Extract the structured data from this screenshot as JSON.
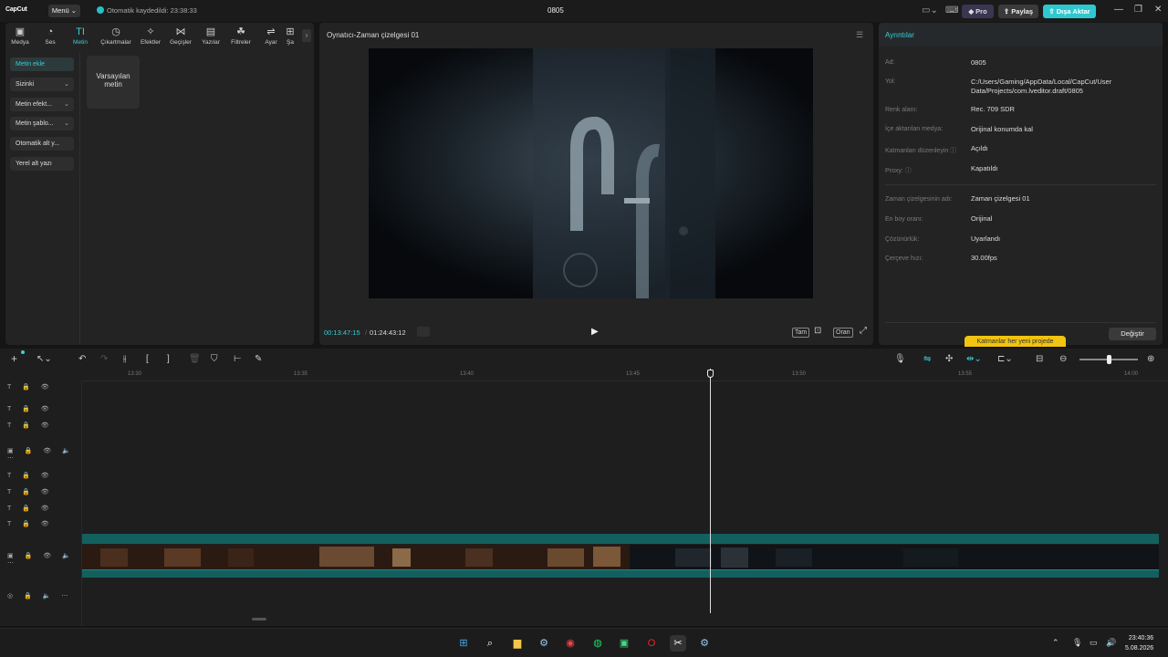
{
  "titlebar": {
    "logo": "CapCut",
    "menu_label": "Menü",
    "autosave": "Otomatik kaydedildi: 23:38:33",
    "project_name": "0805",
    "pro_label": "Pro",
    "share_label": "Paylaş",
    "export_label": "Dışa Aktar"
  },
  "tabs": [
    {
      "label": "Medya",
      "icon": "media-icon"
    },
    {
      "label": "Ses",
      "icon": "audio-icon"
    },
    {
      "label": "Metin",
      "icon": "text-icon"
    },
    {
      "label": "Çıkartmalar",
      "icon": "sticker-icon"
    },
    {
      "label": "Efektler",
      "icon": "effects-icon"
    },
    {
      "label": "Geçişler",
      "icon": "transitions-icon"
    },
    {
      "label": "Yazılar",
      "icon": "captions-icon"
    },
    {
      "label": "Filtreler",
      "icon": "filters-icon"
    },
    {
      "label": "Ayar",
      "icon": "adjust-icon"
    },
    {
      "label": "Şa",
      "icon": "template-icon"
    }
  ],
  "sidebar": {
    "items": [
      {
        "label": "Metin ekle"
      },
      {
        "label": "Sizinki"
      },
      {
        "label": "Metin efekt..."
      },
      {
        "label": "Metin şablo..."
      },
      {
        "label": "Otomatik alt y..."
      },
      {
        "label": "Yerel alt yazı"
      }
    ]
  },
  "text_card": {
    "label": "Varsayılan metin"
  },
  "player": {
    "title": "Oynatıcı-Zaman çizelgesi 01",
    "current_time": "00:13:47:15",
    "total_time": "01:24:43:12",
    "full_label": "Tam",
    "ratio_label": "Oran"
  },
  "details": {
    "header": "Ayrıntılar",
    "rows": [
      {
        "key": "Ad:",
        "value": "0805"
      },
      {
        "key": "Yol:",
        "value": "C:/Users/Gaming/AppData/Local/CapCut/User Data/Projects/com.lveditor.draft/0805"
      },
      {
        "key": "Renk alanı:",
        "value": "Rec. 709 SDR"
      },
      {
        "key": "İçe aktarılan medya:",
        "value": "Orijinal konumda kal"
      },
      {
        "key": "Katmanları düzenleyin",
        "value": "Açıldı"
      },
      {
        "key": "Proxy:",
        "value": "Kapatıldı"
      },
      {
        "key": "Zaman çizelgesinin adı:",
        "value": "Zaman çizelgesi 01"
      },
      {
        "key": "En boy oranı:",
        "value": "Orijinal"
      },
      {
        "key": "Çözünürlük:",
        "value": "Uyarlandı"
      },
      {
        "key": "Çerçeve hızı:",
        "value": "30.00fps"
      }
    ],
    "tooltip": "Katmanlar her yeni projede",
    "modify_label": "Değiştir"
  },
  "timeline": {
    "ruler": [
      "13:30",
      "13:35",
      "13:40",
      "13:45",
      "13:50",
      "13:55",
      "14:00"
    ],
    "zoom_level": 0.5
  },
  "taskbar": {
    "time": "23:40:36",
    "date": "5.08.2026"
  },
  "colors": {
    "accent": "#38d0d8",
    "export_bg": "#2ec8d0",
    "track_teal": "#13605e",
    "tooltip_bg": "#f1c40f"
  }
}
